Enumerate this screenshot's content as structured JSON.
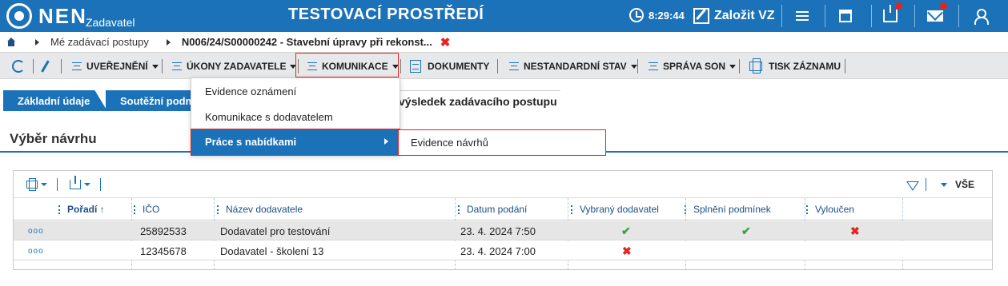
{
  "header": {
    "brand": "NEN",
    "brand_sub": "Zadavatel",
    "environment": "TESTOVACÍ PROSTŘEDÍ",
    "time": "8:29:44",
    "create_label": "Založit VZ",
    "colors": {
      "primary": "#1b72b8",
      "badge": "#e52421"
    }
  },
  "breadcrumb": {
    "item1": "Mé zadávací postupy",
    "item2": "N006/24/S00000242 - Stavební úpravy při rekonst..."
  },
  "toolbar": {
    "publish": "UVEŘEJNĚNÍ",
    "acts": "ÚKONY ZADAVATELE",
    "communication": "KOMUNIKACE",
    "documents": "DOKUMENTY",
    "nonstandard": "NESTANDARDNÍ STAV",
    "son": "SPRÁVA SON",
    "print": "TISK ZÁZNAMU"
  },
  "tabs": {
    "tab1": "Základní údaje",
    "tab2": "Soutěžní podm",
    "tab3": "výsledek zadávacího postupu"
  },
  "section": {
    "title": "Výběr návrhu"
  },
  "grid": {
    "all_label": "VŠE",
    "columns": {
      "order": "Pořadí ↑",
      "ico": "IČO",
      "name": "Název dodavatele",
      "date": "Datum podání",
      "selected": "Vybraný dodavatel",
      "conditions": "Splnění podmínek",
      "excluded": "Vyloučen"
    },
    "rows": [
      {
        "menu": "ooo",
        "ico": "25892533",
        "name": "Dodavatel pro testování",
        "date": "23. 4. 2024 7:50",
        "selected": "✔",
        "conditions": "✔",
        "excluded": "✖"
      },
      {
        "menu": "ooo",
        "ico": "12345678",
        "name": "Dodavatel - školení 13",
        "date": "23. 4. 2024 7:00",
        "selected": "✖",
        "conditions": "",
        "excluded": ""
      }
    ]
  },
  "dropdown": {
    "item1": "Evidence oznámení",
    "item2": "Komunikace s dodavatelem",
    "item3": "Práce s nabídkami",
    "submenu_item": "Evidence návrhů"
  },
  "icons": [
    "logo-icon",
    "clock-icon",
    "edit-icon",
    "menu-icon",
    "calendar-icon",
    "inbox-icon",
    "mail-icon",
    "user-icon",
    "home-icon",
    "refresh-icon",
    "pencil-icon",
    "print-icon",
    "export-icon",
    "filter-icon"
  ]
}
